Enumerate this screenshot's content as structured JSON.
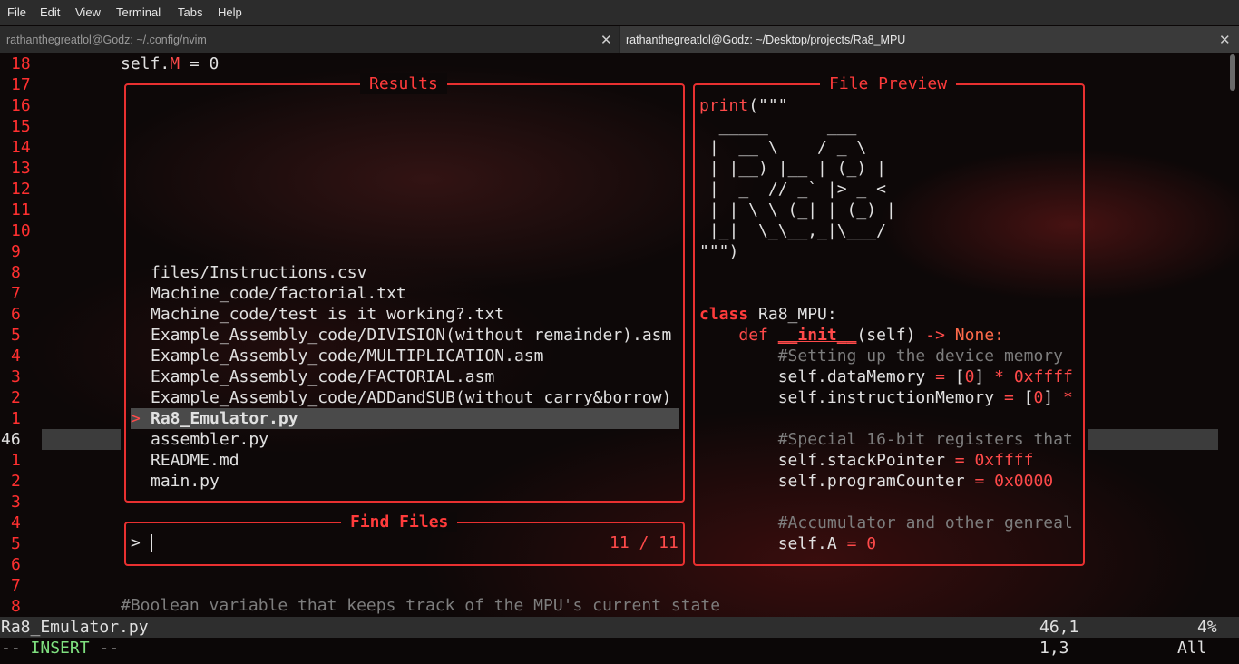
{
  "menu": [
    "File",
    "Edit",
    "View",
    "Terminal",
    "Tabs",
    "Help"
  ],
  "tabs": [
    {
      "title": "rathanthegreatlol@Godz: ~/.config/nvim"
    },
    {
      "title": "rathanthegreatlol@Godz: ~/Desktop/projects/Ra8_MPU"
    }
  ],
  "editor": {
    "line_numbers": [
      "18",
      "17",
      "16",
      "15",
      "14",
      "13",
      "12",
      "11",
      "10",
      "9",
      "8",
      "7",
      "6",
      "5",
      "4",
      "3",
      "2",
      "1",
      "46",
      "1",
      "2",
      "3",
      "4",
      "5",
      "6",
      "7",
      "8"
    ],
    "top_code_a": "self.",
    "top_code_b": "M",
    "top_code_c": " = 0",
    "bottom_comment": "#Boolean variable that keeps track of the MPU's current state"
  },
  "results": {
    "title": "Results",
    "items": [
      "files/Instructions.csv",
      "Machine_code/factorial.txt",
      "Machine_code/test is it working?.txt",
      "Example_Assembly_code/DIVISION(without remainder).asm",
      "Example_Assembly_code/MULTIPLICATION.asm",
      "Example_Assembly_code/FACTORIAL.asm",
      "Example_Assembly_code/ADDandSUB(without carry&borrow)",
      "Ra8_Emulator.py",
      "assembler.py",
      "README.md",
      "main.py"
    ],
    "selected_marker": ">"
  },
  "find": {
    "title": "Find Files",
    "prompt": ">",
    "count": "11 / 11"
  },
  "preview": {
    "title": "File Preview",
    "lines": [
      {
        "t": "print(\"\"\"",
        "c": "mixed_print"
      },
      {
        "t": "  _____      ___  ",
        "c": "w"
      },
      {
        "t": " |  __ \\    / _ \\ ",
        "c": "w"
      },
      {
        "t": " | |__) |__ | (_) |",
        "c": "w"
      },
      {
        "t": " |  _  // _` |> _ < ",
        "c": "w"
      },
      {
        "t": " | | \\ \\ (_| | (_) |",
        "c": "w"
      },
      {
        "t": " |_|  \\_\\__,_|\\___/ ",
        "c": "w"
      },
      {
        "t": "\"\"\")",
        "c": "w"
      },
      {
        "t": "",
        "c": "w"
      },
      {
        "t": "",
        "c": "w"
      },
      {
        "t": "class Ra8_MPU:",
        "c": "class"
      },
      {
        "t": "    def __init__(self) -> None:",
        "c": "def"
      },
      {
        "t": "        #Setting up the device memory",
        "c": "dim"
      },
      {
        "t": "        self.dataMemory = [0] * 0xffff",
        "c": "w"
      },
      {
        "t": "        self.instructionMemory = [0] *",
        "c": "w"
      },
      {
        "t": "",
        "c": "w"
      },
      {
        "t": "        #Special 16-bit registers that",
        "c": "dim"
      },
      {
        "t": "        self.stackPointer = 0xffff",
        "c": "w"
      },
      {
        "t": "        self.programCounter = 0x0000",
        "c": "w"
      },
      {
        "t": "",
        "c": "w"
      },
      {
        "t": "        #Accumulator and other genreal",
        "c": "dim"
      },
      {
        "t": "        self.A = 0",
        "c": "w"
      }
    ]
  },
  "status": {
    "filename": "Ra8_Emulator.py",
    "position": "46,1",
    "percent": "4%",
    "mode": "-- INSERT --",
    "cursor_pos": "1,3",
    "scroll_pos": "All"
  },
  "colors": {
    "accent": "#e83030",
    "text": "#e0e0e0",
    "selection": "#4a4a4a",
    "comment": "#7d7d7d"
  }
}
